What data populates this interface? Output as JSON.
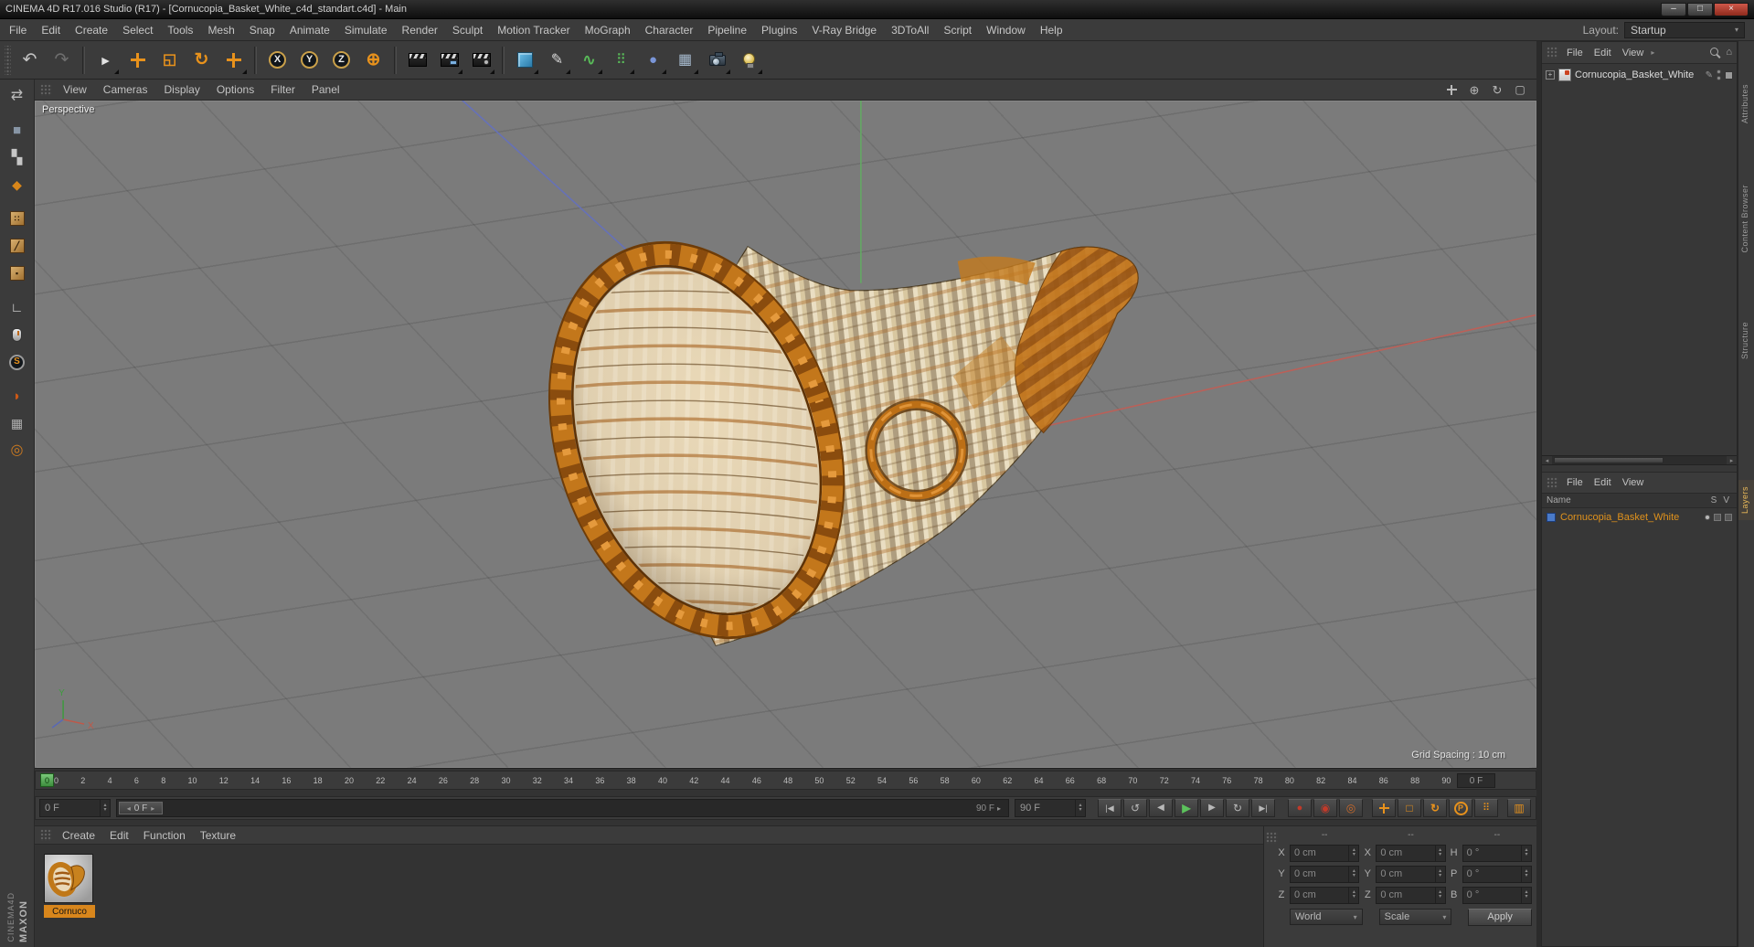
{
  "window": {
    "title": "CINEMA 4D R17.016 Studio (R17) - [Cornucopia_Basket_White_c4d_standart.c4d] - Main",
    "controls": {
      "minimize": "–",
      "maximize": "□",
      "close": "×"
    }
  },
  "glyphs": {
    "up": "▴",
    "down": "▾",
    "left": "◂",
    "right": "▸",
    "plus": "+",
    "pencil": "✎",
    "home": "⌂"
  },
  "menubar": {
    "items": [
      "File",
      "Edit",
      "Create",
      "Select",
      "Tools",
      "Mesh",
      "Snap",
      "Animate",
      "Simulate",
      "Render",
      "Sculpt",
      "Motion Tracker",
      "MoGraph",
      "Character",
      "Pipeline",
      "Plugins",
      "V-Ray Bridge",
      "3DToAll",
      "Script",
      "Window",
      "Help"
    ],
    "layout_label": "Layout:",
    "layout_value": "Startup"
  },
  "toolbar": {
    "icons": [
      {
        "k": "handle"
      },
      {
        "n": "undo-icon",
        "k": "glyph",
        "g": "↶",
        "c": "#c2c2c2",
        "s": 19
      },
      {
        "n": "redo-icon",
        "k": "glyph",
        "g": "↷",
        "c": "#6e6e6e",
        "s": 19
      },
      {
        "k": "sep"
      },
      {
        "n": "live-selection-icon",
        "k": "glyph",
        "g": "►",
        "c": "#e2e2e2",
        "s": 14,
        "f": 1
      },
      {
        "n": "move-icon",
        "k": "cross"
      },
      {
        "n": "scale-icon",
        "k": "glyph",
        "g": "◱",
        "c": "#e8921c",
        "s": 16,
        "b": 1
      },
      {
        "n": "rotate-icon",
        "k": "glyph",
        "g": "↻",
        "c": "#e8921c",
        "s": 19,
        "b": 1
      },
      {
        "n": "last-tool-icon",
        "k": "cross",
        "f": 1
      },
      {
        "k": "sep"
      },
      {
        "n": "lock-x-icon",
        "k": "circle",
        "g": "X"
      },
      {
        "n": "lock-y-icon",
        "k": "circle",
        "g": "Y"
      },
      {
        "n": "lock-z-icon",
        "k": "circle",
        "g": "Z"
      },
      {
        "n": "coordinate-system-icon",
        "k": "glyph",
        "g": "⊕",
        "c": "#e8921c",
        "s": 19,
        "b": 1
      },
      {
        "k": "sep"
      },
      {
        "n": "render-view-icon",
        "k": "clapper"
      },
      {
        "n": "render-picture-viewer-icon",
        "k": "clapper",
        "v": "pv",
        "f": 1
      },
      {
        "n": "render-settings-icon",
        "k": "clapper",
        "v": "gear",
        "f": 1
      },
      {
        "k": "sep"
      },
      {
        "n": "add-cube-icon",
        "k": "cube",
        "f": 1
      },
      {
        "n": "pen-spline-icon",
        "k": "glyph",
        "g": "✎",
        "c": "#d8d8d8",
        "s": 16,
        "f": 1
      },
      {
        "n": "deformer-icon",
        "k": "glyph",
        "g": "∿",
        "c": "#58b858",
        "s": 17,
        "b": 1,
        "f": 1
      },
      {
        "n": "clone-tools-icon",
        "k": "glyph",
        "g": "⠿",
        "c": "#58b858",
        "s": 15,
        "f": 1
      },
      {
        "n": "simulation-icon",
        "k": "glyph",
        "g": "●",
        "c": "#7a96d8",
        "s": 15,
        "f": 1
      },
      {
        "n": "mograph-icon",
        "k": "glyph",
        "g": "▦",
        "c": "#a8bcd0",
        "s": 16,
        "f": 1
      },
      {
        "n": "camera-icon",
        "k": "camera",
        "f": 1
      },
      {
        "n": "light-icon",
        "k": "bulb",
        "f": 1
      }
    ]
  },
  "sidebar": {
    "icons": [
      {
        "n": "make-editable-icon",
        "k": "glyph",
        "g": "⇄",
        "c": "#b8b8b8",
        "s": 16
      },
      {
        "k": "gap"
      },
      {
        "n": "model-mode-icon",
        "k": "glyph",
        "g": "■",
        "c": "#8795a5",
        "s": 15
      },
      {
        "n": "texture-mode-icon",
        "k": "glyph",
        "g": "▚",
        "c": "#c6c6c6",
        "s": 15
      },
      {
        "n": "workplane-mode-icon",
        "k": "glyph",
        "g": "◆",
        "c": "#d8861a",
        "s": 14
      },
      {
        "k": "gap"
      },
      {
        "n": "points-mode-icon",
        "k": "face",
        "g": "∷"
      },
      {
        "n": "edges-mode-icon",
        "k": "face",
        "g": "╱"
      },
      {
        "n": "polygons-mode-icon",
        "k": "face",
        "g": "▪"
      },
      {
        "k": "gap"
      },
      {
        "n": "axis-mode-icon",
        "k": "glyph",
        "g": "∟",
        "c": "#e0e0e0",
        "s": 14,
        "b": 1
      },
      {
        "n": "mouse-navigation-icon",
        "k": "mouse"
      },
      {
        "n": "snap-icon",
        "k": "circle-s",
        "g": "S"
      },
      {
        "k": "gap"
      },
      {
        "n": "brush-icon",
        "k": "glyph",
        "g": "◗",
        "c": "#cc5816",
        "s": 15
      },
      {
        "n": "workplane-lock-icon",
        "k": "glyph",
        "g": "▦",
        "c": "#b0b0b0",
        "s": 14
      },
      {
        "n": "align-workplane-icon",
        "k": "glyph",
        "g": "◎",
        "c": "#cc7a20",
        "s": 16
      }
    ]
  },
  "viewport": {
    "menu": [
      "View",
      "Cameras",
      "Display",
      "Options",
      "Filter",
      "Panel"
    ],
    "label": "Perspective",
    "grid_spacing": "Grid Spacing : 10 cm",
    "nav_icons": [
      {
        "n": "pan-view-icon",
        "k": "cross"
      },
      {
        "n": "zoom-view-icon",
        "k": "glyph",
        "g": "⊕",
        "c": "#b8b8b8",
        "s": 13
      },
      {
        "n": "rotate-view-icon",
        "k": "glyph",
        "g": "↻",
        "c": "#b8b8b8",
        "s": 13
      },
      {
        "n": "toggle-view-icon",
        "k": "glyph",
        "g": "▢",
        "c": "#b8b8b8",
        "s": 12
      }
    ],
    "axis_labels": {
      "x": "X",
      "y": "Y"
    }
  },
  "timeline": {
    "ticks": [
      "0",
      "2",
      "4",
      "6",
      "8",
      "10",
      "12",
      "14",
      "16",
      "18",
      "20",
      "22",
      "24",
      "26",
      "28",
      "30",
      "32",
      "34",
      "36",
      "38",
      "40",
      "42",
      "44",
      "46",
      "48",
      "50",
      "52",
      "54",
      "56",
      "58",
      "60",
      "62",
      "64",
      "66",
      "68",
      "70",
      "72",
      "74",
      "76",
      "78",
      "80",
      "82",
      "84",
      "86",
      "88",
      "90"
    ],
    "marker": "0",
    "end_box": "0 F"
  },
  "transport": {
    "current": "0 F",
    "handle": "0 F",
    "track_end": "90 F",
    "range_field": "90 F",
    "buttons": [
      {
        "n": "goto-start-button",
        "k": "glyph",
        "g": "|◀",
        "s": 9
      },
      {
        "n": "play-backward-button",
        "k": "glyph",
        "g": "↺",
        "s": 12
      },
      {
        "n": "previous-frame-button",
        "k": "glyph",
        "g": "◀",
        "s": 10
      },
      {
        "n": "play-button",
        "k": "glyph",
        "g": "▶",
        "c": "#5cc25c",
        "s": 12,
        "b": 1
      },
      {
        "n": "next-frame-button",
        "k": "glyph",
        "g": "▶",
        "s": 10
      },
      {
        "n": "play-loop-button",
        "k": "glyph",
        "g": "↻",
        "s": 12
      },
      {
        "n": "goto-end-button",
        "k": "glyph",
        "g": "▶|",
        "s": 9
      }
    ],
    "key_buttons": [
      {
        "n": "record-keyframe-button",
        "k": "glyph",
        "g": "●",
        "c": "#c23a2a",
        "s": 11
      },
      {
        "n": "autokey-button",
        "k": "glyph",
        "g": "◉",
        "c": "#c23a2a",
        "s": 12
      },
      {
        "n": "keyframe-selection-button",
        "k": "glyph",
        "g": "◎",
        "c": "#cc6a2a",
        "s": 12
      },
      {
        "k": "tgap"
      },
      {
        "n": "record-position-toggle",
        "k": "cross"
      },
      {
        "n": "record-scale-toggle",
        "k": "glyph",
        "g": "□",
        "c": "#e8921c",
        "s": 12,
        "b": 1
      },
      {
        "n": "record-rotation-toggle",
        "k": "glyph",
        "g": "↻",
        "c": "#e8921c",
        "s": 12,
        "b": 1
      },
      {
        "n": "record-parameter-toggle",
        "k": "circle-p",
        "g": "P"
      },
      {
        "n": "record-pla-toggle",
        "k": "glyph",
        "g": "⠿",
        "c": "#e8921c",
        "s": 11
      },
      {
        "k": "tgap"
      },
      {
        "n": "powerslider-options-button",
        "k": "glyph",
        "g": "▥",
        "c": "#e8921c",
        "s": 12
      }
    ]
  },
  "materials": {
    "menu": [
      "Create",
      "Edit",
      "Function",
      "Texture"
    ],
    "items": [
      {
        "name": "Cornuco"
      }
    ]
  },
  "coordinates": {
    "headers": [
      "--",
      "--",
      "--"
    ],
    "rows": [
      {
        "pl": "X",
        "pv": "0 cm",
        "sl": "X",
        "sv": "0 cm",
        "rl": "H",
        "rv": "0 °"
      },
      {
        "pl": "Y",
        "pv": "0 cm",
        "sl": "Y",
        "sv": "0 cm",
        "rl": "P",
        "rv": "0 °"
      },
      {
        "pl": "Z",
        "pv": "0 cm",
        "sl": "Z",
        "sv": "0 cm",
        "rl": "B",
        "rv": "0 °"
      }
    ],
    "world": "World",
    "scale": "Scale",
    "apply": "Apply"
  },
  "object_manager": {
    "menu": [
      "File",
      "Edit",
      "View"
    ],
    "objects": [
      {
        "name": "Cornucopia_Basket_White"
      }
    ]
  },
  "layer_manager": {
    "menu": [
      "File",
      "Edit",
      "View"
    ],
    "name_header": "Name",
    "col_s": "S",
    "col_v": "V",
    "layers": [
      {
        "name": "Cornucopia_Basket_White"
      }
    ]
  },
  "right_tabs": [
    {
      "label": "Attributes",
      "active": false
    },
    {
      "label": "Content Browser",
      "active": false
    },
    {
      "label": "Structure",
      "active": false
    },
    {
      "label": "Layers",
      "active": true
    }
  ],
  "brand": {
    "line1": "MAXON",
    "line2": "CINEMA4D"
  },
  "colors": {
    "accent": "#e8921c",
    "viewport_bg": "#7b7b7b",
    "chrome": "#3b3b3b",
    "green_axis": "#63a863",
    "red_axis": "#bb6058",
    "blue_axis": "#6671b8"
  }
}
